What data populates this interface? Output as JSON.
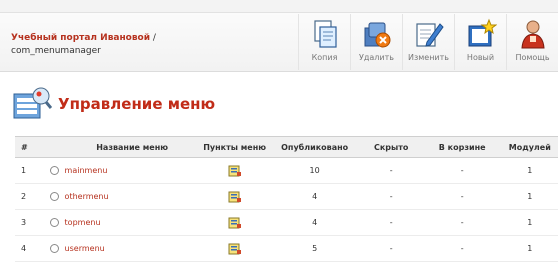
{
  "header": {
    "site_name": "Учебный портал Ивановой",
    "separator": " /",
    "component": "com_menumanager"
  },
  "toolbar": [
    {
      "label": "Копия",
      "icon": "copy-icon"
    },
    {
      "label": "Удалить",
      "icon": "delete-icon"
    },
    {
      "label": "Изменить",
      "icon": "edit-icon"
    },
    {
      "label": "Новый",
      "icon": "new-icon"
    },
    {
      "label": "Помощь",
      "icon": "help-icon"
    }
  ],
  "page": {
    "title": "Управление меню",
    "icon": "menu-manager-icon"
  },
  "table": {
    "headers": {
      "num": "#",
      "name": "Название меню",
      "items": "Пункты меню",
      "published": "Опубликовано",
      "hidden": "Скрыто",
      "trash": "В корзине",
      "modules": "Модулей"
    },
    "rows": [
      {
        "num": "1",
        "name": "mainmenu",
        "published": "10",
        "hidden": "-",
        "trash": "-",
        "modules": "1"
      },
      {
        "num": "2",
        "name": "othermenu",
        "published": "4",
        "hidden": "-",
        "trash": "-",
        "modules": "1"
      },
      {
        "num": "3",
        "name": "topmenu",
        "published": "4",
        "hidden": "-",
        "trash": "-",
        "modules": "1"
      },
      {
        "num": "4",
        "name": "usermenu",
        "published": "5",
        "hidden": "-",
        "trash": "-",
        "modules": "1"
      }
    ]
  }
}
